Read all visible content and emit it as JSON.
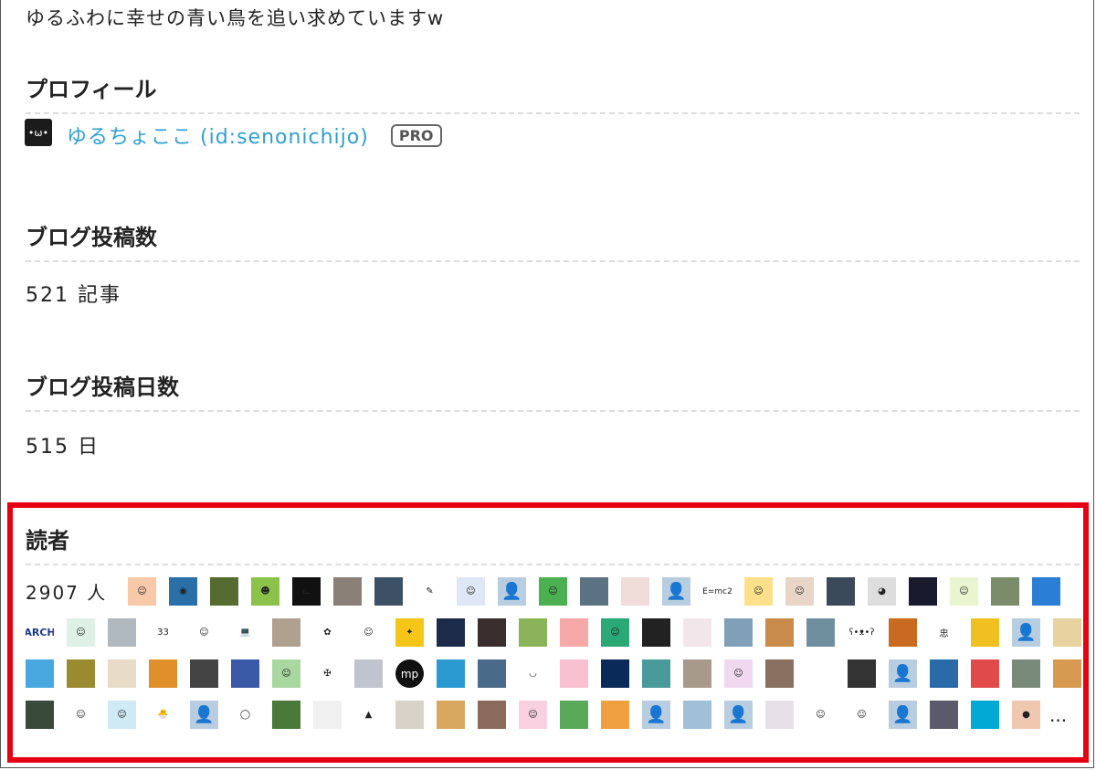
{
  "tagline": "ゆるふわに幸せの青い鳥を追い求めていますw",
  "profile": {
    "title": "プロフィール",
    "avatar_text": "•ω•",
    "username": "ゆるちょここ (id:senonichijo)",
    "badge": "PRO"
  },
  "posts": {
    "title": "ブログ投稿数",
    "value": "521 記事"
  },
  "days": {
    "title": "ブログ投稿日数",
    "value": "515 日"
  },
  "readers": {
    "title": "読者",
    "count": "2907 人",
    "more": "...",
    "rows": [
      [
        {
          "icon": "face-icon",
          "color": "#f7c9a8",
          "glyph": "☺"
        },
        {
          "icon": "eye-icon",
          "color": "#2a6fa8",
          "glyph": "◉"
        },
        {
          "icon": "photo-icon",
          "color": "#556b2f",
          "glyph": ""
        },
        {
          "icon": "frog-icon",
          "color": "#8bc34a",
          "glyph": "☻"
        },
        {
          "icon": "cat-icon",
          "color": "#111111",
          "glyph": "ᓚ"
        },
        {
          "icon": "cat-photo-icon",
          "color": "#8a8078",
          "glyph": ""
        },
        {
          "icon": "painting-icon",
          "color": "#3e5066",
          "glyph": ""
        },
        {
          "icon": "note-icon",
          "color": "#ffffff",
          "glyph": "✎"
        },
        {
          "icon": "character-icon",
          "color": "#dfe6f5",
          "glyph": "☺"
        },
        {
          "icon": "default-avatar-icon",
          "color": "#b9cde0",
          "glyph": "👤"
        },
        {
          "icon": "character-icon",
          "color": "#4caf50",
          "glyph": "☺"
        },
        {
          "icon": "landscape-icon",
          "color": "#5b7282",
          "glyph": ""
        },
        {
          "icon": "character-icon",
          "color": "#f0dcd8",
          "glyph": ""
        },
        {
          "icon": "default-avatar-icon",
          "color": "#b9cde0",
          "glyph": "👤"
        },
        {
          "icon": "text-logo-icon",
          "color": "#ffffff",
          "glyph": "E=mc2"
        },
        {
          "icon": "face-icon",
          "color": "#ffe08a",
          "glyph": "☺"
        },
        {
          "icon": "character-icon",
          "color": "#e8d5c8",
          "glyph": "☺"
        },
        {
          "icon": "person-photo-icon",
          "color": "#3a4a5a",
          "glyph": ""
        },
        {
          "icon": "dog-icon",
          "color": "#dddddd",
          "glyph": "◕"
        },
        {
          "icon": "fish-icon",
          "color": "#1a1a2e",
          "glyph": ""
        },
        {
          "icon": "character-icon",
          "color": "#e8f5d0",
          "glyph": "☺"
        },
        {
          "icon": "person-photo-icon",
          "color": "#7a8c6a",
          "glyph": ""
        },
        {
          "icon": "bird-icon",
          "color": "#2a7fd4",
          "glyph": ""
        }
      ],
      [
        {
          "icon": "text-logo-icon",
          "color": "#ffffff",
          "glyph": "ARCH"
        },
        {
          "icon": "girl-icon",
          "color": "#dff1e6",
          "glyph": "☺"
        },
        {
          "icon": "photo-icon",
          "color": "#b0b8c0",
          "glyph": ""
        },
        {
          "icon": "number-icon",
          "color": "#ffffff",
          "glyph": "33"
        },
        {
          "icon": "person-icon",
          "color": "#ffffff",
          "glyph": "☺"
        },
        {
          "icon": "laptop-icon",
          "color": "#ffffff",
          "glyph": "💻"
        },
        {
          "icon": "person-photo-icon",
          "color": "#b0a090",
          "glyph": ""
        },
        {
          "icon": "rose-icon",
          "color": "#ffffff",
          "glyph": "✿"
        },
        {
          "icon": "face-icon",
          "color": "#ffffff",
          "glyph": "☺"
        },
        {
          "icon": "badge-icon",
          "color": "#f5c518",
          "glyph": "✦"
        },
        {
          "icon": "space-icon",
          "color": "#1d2b4a",
          "glyph": ""
        },
        {
          "icon": "photo-icon",
          "color": "#3a2e2e",
          "glyph": ""
        },
        {
          "icon": "flower-icon",
          "color": "#8ab35a",
          "glyph": ""
        },
        {
          "icon": "colorful-icon",
          "color": "#f7a8a8",
          "glyph": ""
        },
        {
          "icon": "character-icon",
          "color": "#2aa876",
          "glyph": "☺"
        },
        {
          "icon": "car-icon",
          "color": "#222222",
          "glyph": ""
        },
        {
          "icon": "flower-icon",
          "color": "#f3e6ea",
          "glyph": ""
        },
        {
          "icon": "landscape-icon",
          "color": "#7fa0b8",
          "glyph": ""
        },
        {
          "icon": "landscape-icon",
          "color": "#c98a4a",
          "glyph": ""
        },
        {
          "icon": "landscape-icon",
          "color": "#6f8f9f",
          "glyph": ""
        },
        {
          "icon": "polar-bear-icon",
          "color": "#ffffff",
          "glyph": "ʕ•ᴥ•ʔ"
        },
        {
          "icon": "bear-icon",
          "color": "#c86a20",
          "glyph": ""
        },
        {
          "icon": "calligraphy-icon",
          "color": "#ffffff",
          "glyph": "忠"
        },
        {
          "icon": "sunflower-icon",
          "color": "#f0c020",
          "glyph": ""
        },
        {
          "icon": "default-avatar-icon",
          "color": "#b9cde0",
          "glyph": "👤"
        },
        {
          "icon": "food-icon",
          "color": "#e8d2a0",
          "glyph": ""
        }
      ],
      [
        {
          "icon": "sea-icon",
          "color": "#4aa8e0",
          "glyph": ""
        },
        {
          "icon": "tree-icon",
          "color": "#9a8a30",
          "glyph": ""
        },
        {
          "icon": "sketch-icon",
          "color": "#e8dcc8",
          "glyph": ""
        },
        {
          "icon": "food-icon",
          "color": "#e0902a",
          "glyph": ""
        },
        {
          "icon": "person-photo-icon",
          "color": "#444444",
          "glyph": ""
        },
        {
          "icon": "robot-icon",
          "color": "#3a5aa8",
          "glyph": ""
        },
        {
          "icon": "character-icon",
          "color": "#a8d8a0",
          "glyph": "☺"
        },
        {
          "icon": "dragonfly-icon",
          "color": "#ffffff",
          "glyph": "✠"
        },
        {
          "icon": "photo-icon",
          "color": "#c0c4cc",
          "glyph": ""
        },
        {
          "icon": "text-logo-icon",
          "color": "#111111",
          "glyph": "mp"
        },
        {
          "icon": "bird-icon",
          "color": "#2a9ad0",
          "glyph": ""
        },
        {
          "icon": "landscape-icon",
          "color": "#4a6a8a",
          "glyph": ""
        },
        {
          "icon": "sketch-icon",
          "color": "#ffffff",
          "glyph": "◡"
        },
        {
          "icon": "cute-icon",
          "color": "#f8c0d0",
          "glyph": ""
        },
        {
          "icon": "jellyfish-icon",
          "color": "#0a2a5a",
          "glyph": ""
        },
        {
          "icon": "photo-icon",
          "color": "#4a9a9a",
          "glyph": ""
        },
        {
          "icon": "photo-icon",
          "color": "#a89a8a",
          "glyph": ""
        },
        {
          "icon": "character-icon",
          "color": "#f0d8f0",
          "glyph": "☺"
        },
        {
          "icon": "animal-photo-icon",
          "color": "#8a7060",
          "glyph": ""
        },
        {
          "icon": "cat-photo-icon",
          "color": "#ffffff",
          "glyph": ""
        },
        {
          "icon": "gorilla-icon",
          "color": "#333333",
          "glyph": ""
        },
        {
          "icon": "default-avatar-icon",
          "color": "#b9cde0",
          "glyph": "👤"
        },
        {
          "icon": "surf-icon",
          "color": "#2a6aa8",
          "glyph": ""
        },
        {
          "icon": "puzzle-icon",
          "color": "#e04a4a",
          "glyph": ""
        },
        {
          "icon": "photo-icon",
          "color": "#7a8a7a",
          "glyph": ""
        },
        {
          "icon": "bread-icon",
          "color": "#d89a50",
          "glyph": ""
        }
      ],
      [
        {
          "icon": "photo-icon",
          "color": "#3a4a3a",
          "glyph": ""
        },
        {
          "icon": "old-man-icon",
          "color": "#ffffff",
          "glyph": "☺"
        },
        {
          "icon": "character-icon",
          "color": "#d0eaf5",
          "glyph": "☺"
        },
        {
          "icon": "chick-icon",
          "color": "#ffffff",
          "glyph": "🐣"
        },
        {
          "icon": "default-avatar-icon",
          "color": "#b9cde0",
          "glyph": "👤"
        },
        {
          "icon": "sketch-icon",
          "color": "#ffffff",
          "glyph": "◯"
        },
        {
          "icon": "forest-icon",
          "color": "#4a7a3a",
          "glyph": ""
        },
        {
          "icon": "shirt-icon",
          "color": "#f0f0f0",
          "glyph": ""
        },
        {
          "icon": "ghost-icon",
          "color": "#ffffff",
          "glyph": "▲"
        },
        {
          "icon": "sketch-icon",
          "color": "#d8d2c8",
          "glyph": ""
        },
        {
          "icon": "dog-icon",
          "color": "#d8a860",
          "glyph": ""
        },
        {
          "icon": "building-icon",
          "color": "#8a6a5a",
          "glyph": ""
        },
        {
          "icon": "pink-character-icon",
          "color": "#f8d0e0",
          "glyph": "☺"
        },
        {
          "icon": "landscape-icon",
          "color": "#5aa85a",
          "glyph": ""
        },
        {
          "icon": "food-icon",
          "color": "#f0a040",
          "glyph": ""
        },
        {
          "icon": "default-avatar-icon",
          "color": "#b9cde0",
          "glyph": "👤"
        },
        {
          "icon": "cloud-icon",
          "color": "#a0c0d8",
          "glyph": ""
        },
        {
          "icon": "default-avatar-icon",
          "color": "#b9cde0",
          "glyph": "👤"
        },
        {
          "icon": "mask-person-icon",
          "color": "#e8e0e8",
          "glyph": ""
        },
        {
          "icon": "girl-icon",
          "color": "#ffffff",
          "glyph": "☺"
        },
        {
          "icon": "boy-icon",
          "color": "#ffffff",
          "glyph": "☺"
        },
        {
          "icon": "default-avatar-icon",
          "color": "#b9cde0",
          "glyph": "👤"
        },
        {
          "icon": "person-photo-icon",
          "color": "#5a5a6a",
          "glyph": ""
        },
        {
          "icon": "logo-icon",
          "color": "#00aad4",
          "glyph": ""
        },
        {
          "icon": "play-icon",
          "color": "#f0c8b0",
          "glyph": "●"
        }
      ]
    ]
  }
}
